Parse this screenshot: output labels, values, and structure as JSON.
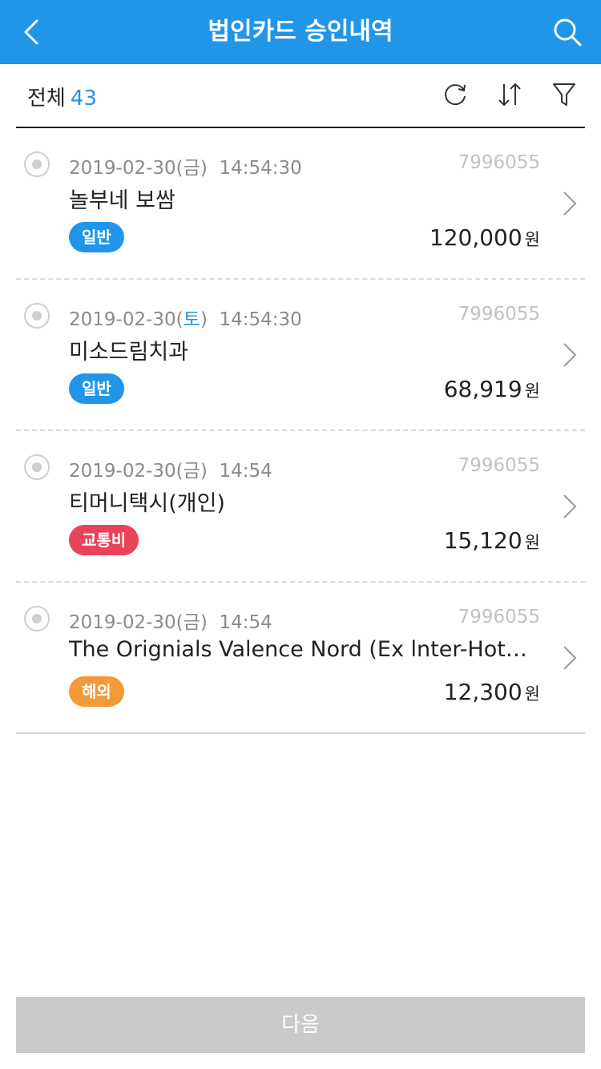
{
  "header": {
    "title": "법인카드 승인내역"
  },
  "toolbar": {
    "total_label": "전체",
    "total_count": "43"
  },
  "colors": {
    "accent": "#2196e9",
    "general": "#2196e9",
    "transport": "#e84358",
    "overseas": "#f2993a",
    "disabled": "#cacaca"
  },
  "icons": {
    "back": "chevron-left-icon",
    "search": "search-icon",
    "refresh": "refresh-icon",
    "sort": "sort-icon",
    "filter": "filter-icon",
    "detail": "chevron-right-icon",
    "select": "radio-icon"
  },
  "items": [
    {
      "date": "2019-02-30",
      "paren_open": "(",
      "day": "금",
      "paren_close": ")",
      "time": "14:54:30",
      "approval_no": "7996055",
      "merchant": "놀부네 보쌈",
      "category": "일반",
      "category_color": "#2196e9",
      "amount": "120,000",
      "currency": "원"
    },
    {
      "date": "2019-02-30",
      "paren_open": "(",
      "day": "토",
      "paren_close": ")",
      "time": "14:54:30",
      "approval_no": "7996055",
      "merchant": "미소드림치과",
      "category": "일반",
      "category_color": "#2196e9",
      "amount": "68,919",
      "currency": "원"
    },
    {
      "date": "2019-02-30",
      "paren_open": "(",
      "day": "금",
      "paren_close": ")",
      "time": "14:54",
      "approval_no": "7996055",
      "merchant": "티머니택시(개인)",
      "category": "교통비",
      "category_color": "#e84358",
      "amount": "15,120",
      "currency": "원"
    },
    {
      "date": "2019-02-30",
      "paren_open": "(",
      "day": "금",
      "paren_close": ")",
      "time": "14:54",
      "approval_no": "7996055",
      "merchant": "The Orignials Valence Nord (Ex lnter-Hot…",
      "category": "해외",
      "category_color": "#f2993a",
      "amount": "12,300",
      "currency": "원"
    }
  ],
  "footer": {
    "next_label": "다음"
  }
}
